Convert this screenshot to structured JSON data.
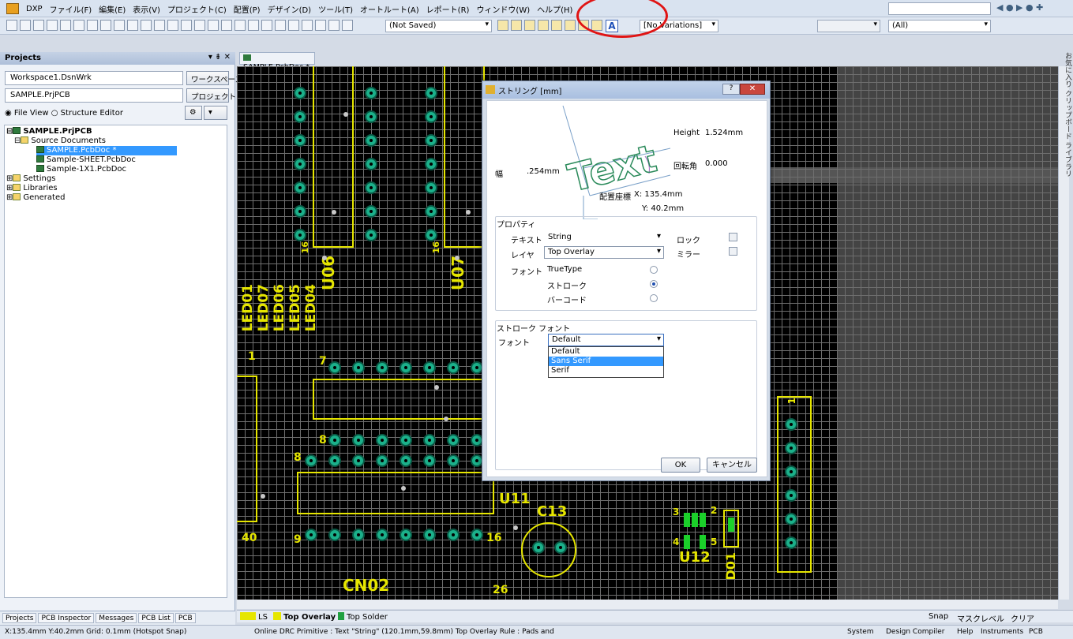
{
  "menu": {
    "items": [
      "DXP",
      "ファイル(F)",
      "編集(E)",
      "表示(V)",
      "プロジェクト(C)",
      "配置(P)",
      "デザイン(D)",
      "ツール(T)",
      "オートルート(A)",
      "レポート(R)",
      "ウィンドウ(W)",
      "ヘルプ(H)"
    ]
  },
  "toolbar": {
    "saved_state": "(Not Saved)",
    "variations": "[No Variations]",
    "filter_all": "(All)"
  },
  "projects": {
    "title": "Projects",
    "controls": "▾ ⇟ ✕",
    "workspace": "Workspace1.DsnWrk",
    "workspace_button": "ワークスペース",
    "project": "SAMPLE.PrjPCB",
    "project_button": "プロジェクト",
    "view_file": "File View",
    "view_structure": "Structure Editor",
    "tree": {
      "root": "SAMPLE.PrjPCB",
      "source_docs": "Source Documents",
      "doc1": "SAMPLE.PcbDoc *",
      "doc2": "Sample-SHEET.PcbDoc",
      "doc3": "Sample-1X1.PcbDoc",
      "settings": "Settings",
      "libraries": "Libraries",
      "generated": "Generated"
    },
    "tabs": [
      "Projects",
      "PCB Inspector",
      "Messages",
      "PCB List",
      "PCB"
    ]
  },
  "document": {
    "tab": "SAMPLE.PcbDoc *"
  },
  "pcb": {
    "u06": "U06",
    "u07": "U07",
    "led": [
      "LED01",
      "LED07",
      "LED06",
      "LED05",
      "LED04"
    ],
    "u11": "U11",
    "c13": "C13",
    "u12": "U12",
    "d01": "D01",
    "cn02": "CN02",
    "n16a": "16",
    "n16b": "16",
    "n1": "1",
    "n7": "7",
    "n8a": "8",
    "n8b": "8",
    "n9": "9",
    "n40": "40",
    "n16c": "16",
    "n26": "26",
    "n3": "3",
    "n4": "4",
    "n5": "5",
    "n2": "2",
    "nb1": "1"
  },
  "dialog": {
    "title": "ストリング [mm]",
    "help": "?",
    "close": "✕",
    "preview_text": "Text",
    "height_label": "Height",
    "height_value": "1.524mm",
    "rotation_label": "回転角",
    "rotation_value": "0.000",
    "width_label": "幅",
    "width_value": ".254mm",
    "location_label": "配置座標",
    "x_value": "X: 135.4mm",
    "y_value": "Y: 40.2mm",
    "properties_label": "プロパティ",
    "text_label": "テキスト",
    "text_value": "String",
    "layer_label": "レイヤ",
    "layer_value": "Top Overlay",
    "font_label": "フォント",
    "truetype": "TrueType",
    "stroke": "ストローク",
    "barcode": "バーコード",
    "lock_label": "ロック",
    "mirror_label": "ミラー",
    "stroke_font_label": "ストローク フォント",
    "stroke_font_field_label": "フォント",
    "stroke_font_value": "Default",
    "font_options": [
      "Default",
      "Sans Serif",
      "Serif"
    ],
    "ok": "OK",
    "cancel": "キャンセル"
  },
  "layers": {
    "ls": "LS",
    "top_overlay": "Top Overlay",
    "top_solder": "Top Solder",
    "snap": "Snap",
    "mask_level": "マスクレベル",
    "clear": "クリア"
  },
  "status": {
    "coords": "X:135.4mm Y:40.2mm   Grid: 0.1mm     (Hotspot Snap)",
    "drc": "Online DRC Primitive : Text \"String\" (120.1mm,59.8mm)  Top Overlay Rule : Pads and",
    "right": [
      "System",
      "Design Compiler",
      "Help",
      "Instruments",
      "PCB"
    ]
  },
  "right_panel": {
    "labels": [
      "お気に入り",
      "クリップボード",
      "ライブラリ"
    ]
  },
  "colors": {
    "silkscreen": "#e6e600",
    "pad": "#1bb08a",
    "selection": "#3399ff",
    "annotation": "#e01414"
  }
}
